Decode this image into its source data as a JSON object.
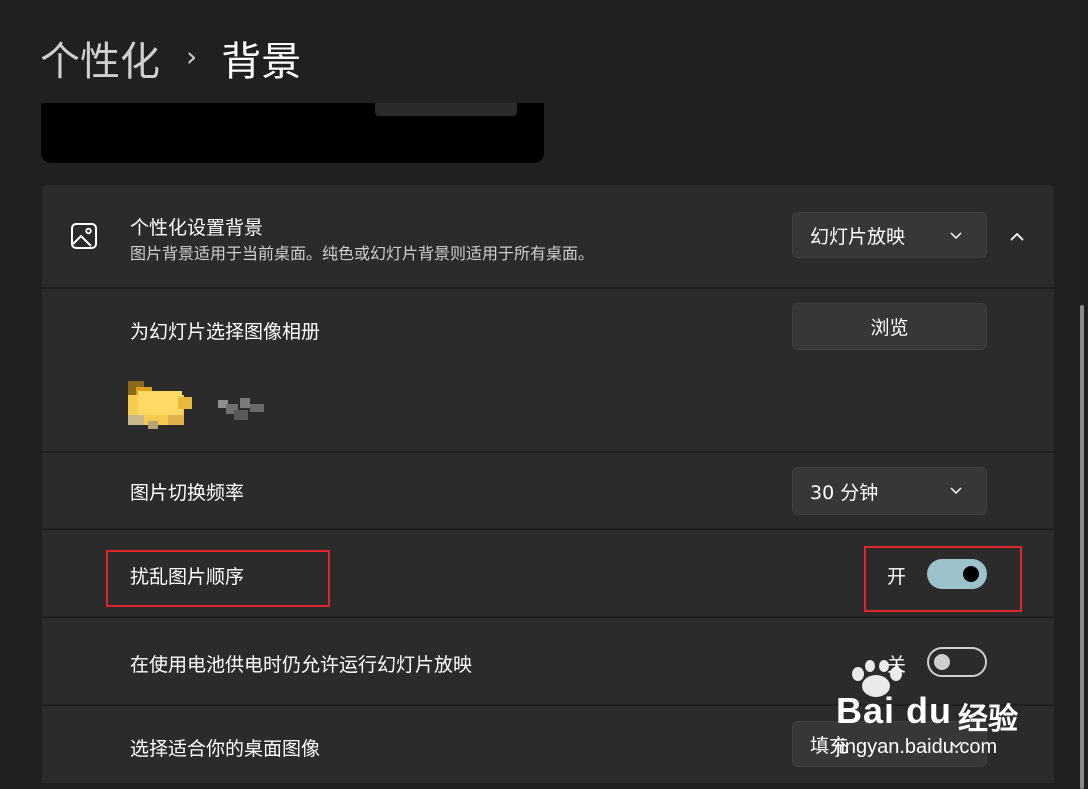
{
  "breadcrumb": {
    "parent": "个性化",
    "separator": "›",
    "current": "背景"
  },
  "background_card": {
    "title": "个性化设置背景",
    "description": "图片背景适用于当前桌面。纯色或幻灯片背景则适用于所有桌面。",
    "type_dropdown": {
      "value": "幻灯片放映"
    }
  },
  "album": {
    "label": "为幻灯片选择图像相册",
    "browse_label": "浏览"
  },
  "interval": {
    "label": "图片切换频率",
    "value": "30 分钟"
  },
  "shuffle": {
    "label": "扰乱图片顺序",
    "state": "开",
    "enabled": true
  },
  "battery": {
    "label": "在使用电池供电时仍允许运行幻灯片放映",
    "state": "关",
    "enabled": false
  },
  "fit": {
    "label": "选择适合你的桌面图像",
    "value": "填充"
  },
  "watermark": {
    "brand": "Bai du",
    "experience": "经验",
    "site": "jingyan.baidu.com"
  },
  "colors": {
    "highlight": "#e0262b",
    "toggle_on": "#9cc3cc",
    "card": "#2b2b2b",
    "background": "#202020"
  }
}
